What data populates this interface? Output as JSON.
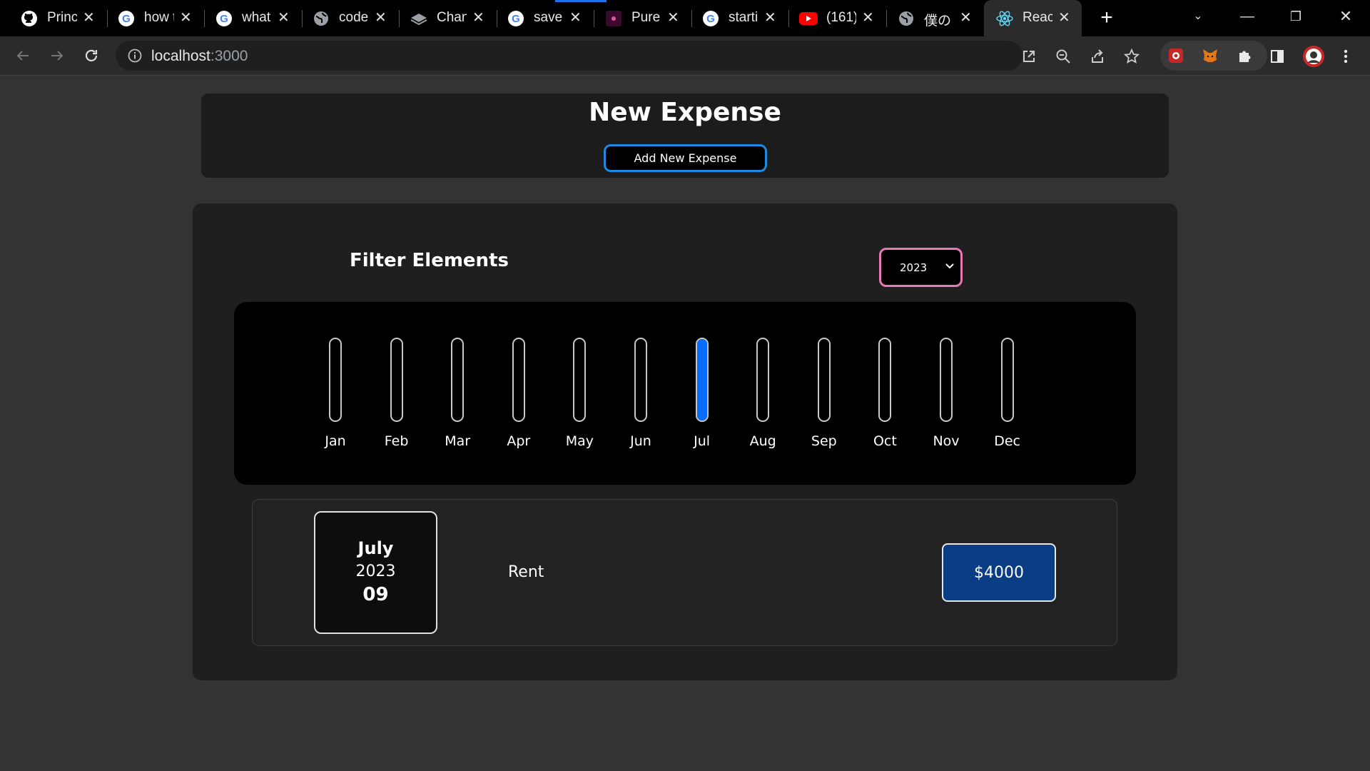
{
  "browser": {
    "tabs": [
      {
        "title": "Princ",
        "icon": "github-icon"
      },
      {
        "title": "how t",
        "icon": "google-icon"
      },
      {
        "title": "what",
        "icon": "google-icon"
      },
      {
        "title": "code",
        "icon": "globe-icon"
      },
      {
        "title": "Chan",
        "icon": "layers-icon"
      },
      {
        "title": "save",
        "icon": "google-icon"
      },
      {
        "title": "Pure",
        "icon": "pure-icon"
      },
      {
        "title": "starti",
        "icon": "google-icon"
      },
      {
        "title": "(161)",
        "icon": "youtube-icon"
      },
      {
        "title": "僕の",
        "icon": "globe-icon"
      },
      {
        "title": "React",
        "icon": "react-icon"
      }
    ],
    "url_host": "localhost",
    "url_port": ":3000"
  },
  "header": {
    "title": "New Expense",
    "add_button_label": "Add New Expense"
  },
  "filter": {
    "title": "Filter Elements",
    "selected_year": "2023"
  },
  "chart_data": {
    "type": "bar",
    "categories": [
      "Jan",
      "Feb",
      "Mar",
      "Apr",
      "May",
      "Jun",
      "Jul",
      "Aug",
      "Sep",
      "Oct",
      "Nov",
      "Dec"
    ],
    "values": [
      0,
      0,
      0,
      0,
      0,
      0,
      4000,
      0,
      0,
      0,
      0,
      0
    ],
    "ylim": [
      0,
      4000
    ]
  },
  "expenses": [
    {
      "month": "July",
      "year": "2023",
      "day": "09",
      "title": "Rent",
      "amount": "$4000"
    }
  ],
  "colors": {
    "bar_fill": "#0a6cff",
    "price_bg": "#0a3d84",
    "select_border": "#e879b9",
    "button_border": "#1e88e5"
  }
}
